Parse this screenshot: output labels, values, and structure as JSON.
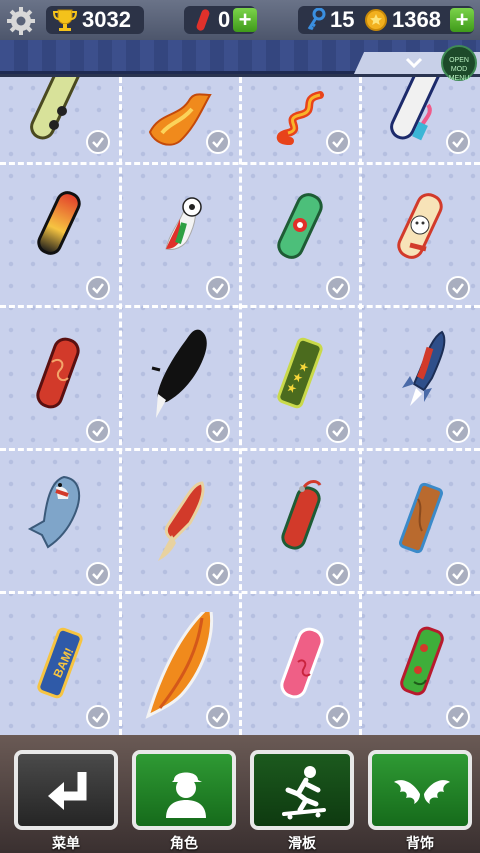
{
  "hud": {
    "trophies": "3032",
    "boards_count": "0",
    "keys": "15",
    "coins": "1368",
    "plus_label": "+"
  },
  "mod_menu": {
    "line1": "OPEN",
    "line2": "MOD MENU"
  },
  "skateboards": [
    {
      "name": "panda-board",
      "owned": true
    },
    {
      "name": "flame-board",
      "owned": true
    },
    {
      "name": "dragon-board",
      "owned": true
    },
    {
      "name": "flamingo-board",
      "owned": true
    },
    {
      "name": "sunset-board",
      "owned": true
    },
    {
      "name": "soccer-board",
      "owned": true
    },
    {
      "name": "flower-board",
      "owned": true
    },
    {
      "name": "cat-board",
      "owned": true
    },
    {
      "name": "swirl-board",
      "owned": true
    },
    {
      "name": "shadow-board",
      "owned": true
    },
    {
      "name": "stars-board",
      "owned": true
    },
    {
      "name": "rocket-board",
      "owned": true
    },
    {
      "name": "shark-board",
      "owned": true
    },
    {
      "name": "fish-board",
      "owned": true
    },
    {
      "name": "firework-board",
      "owned": true
    },
    {
      "name": "wood-board",
      "owned": true
    },
    {
      "name": "bam-board",
      "owned": true
    },
    {
      "name": "surf-board",
      "owned": true
    },
    {
      "name": "pink-board",
      "owned": true
    },
    {
      "name": "monster-board",
      "owned": true
    }
  ],
  "bam_text": "BAM!",
  "nav": [
    {
      "label": "菜单"
    },
    {
      "label": "角色"
    },
    {
      "label": "滑板"
    },
    {
      "label": "背饰"
    }
  ]
}
